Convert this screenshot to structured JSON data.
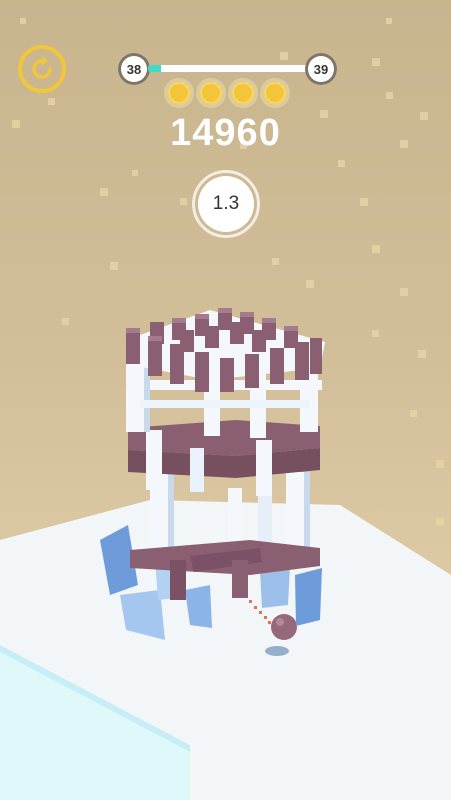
{
  "hud": {
    "restart_icon": "restart-icon",
    "level_current": "38",
    "level_next": "39",
    "level_progress": 0.08,
    "stars_earned": 4,
    "score": "14960",
    "multiplier": "1.3"
  },
  "colors": {
    "sky": "#c8b48d",
    "floor": "#f3f6f8",
    "tower_beam": "#f4f8fc",
    "tower_block": "#8a5f72",
    "accent": "#f2c63b",
    "progress": "#3fd9c5",
    "ball": "#96687b"
  }
}
